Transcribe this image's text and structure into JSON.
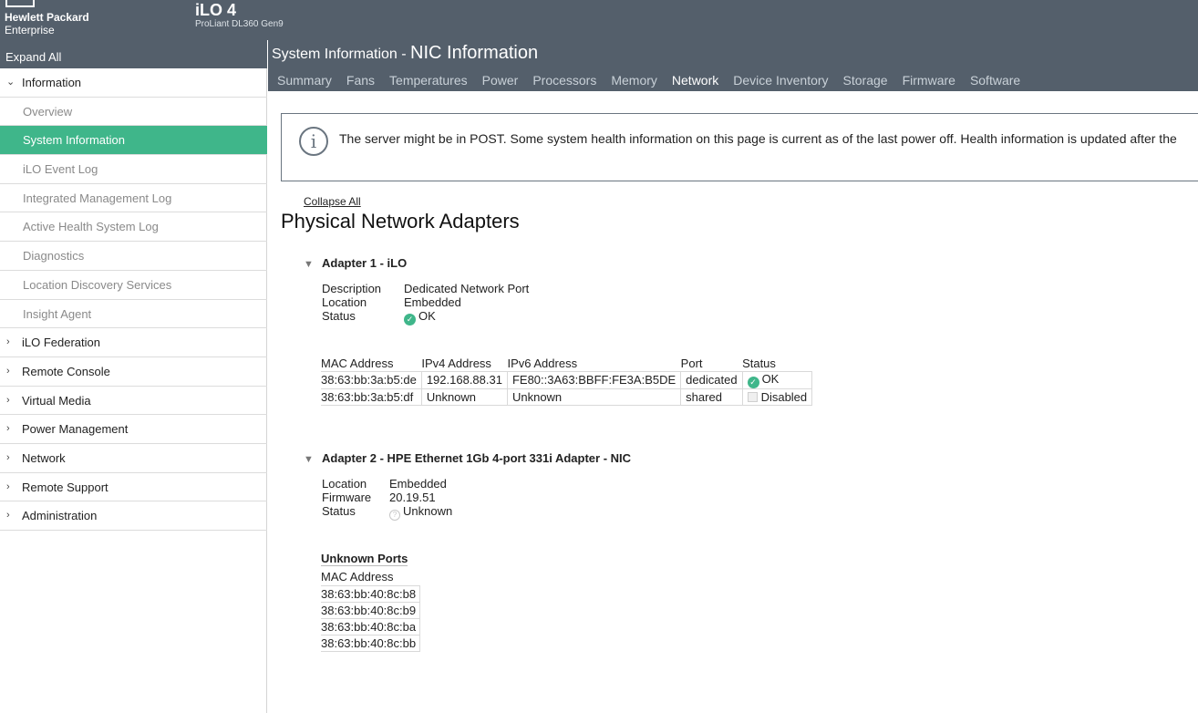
{
  "brand": {
    "line1": "Hewlett Packard",
    "line2": "Enterprise"
  },
  "product": {
    "name": "iLO 4",
    "model": "ProLiant DL360 Gen9"
  },
  "sidebar": {
    "expand_all": "Expand All",
    "items": [
      {
        "label": "Information",
        "type": "section",
        "expanded": true
      },
      {
        "label": "Overview",
        "type": "sub"
      },
      {
        "label": "System Information",
        "type": "sub",
        "active": true
      },
      {
        "label": "iLO Event Log",
        "type": "sub"
      },
      {
        "label": "Integrated Management Log",
        "type": "sub"
      },
      {
        "label": "Active Health System Log",
        "type": "sub"
      },
      {
        "label": "Diagnostics",
        "type": "sub"
      },
      {
        "label": "Location Discovery Services",
        "type": "sub"
      },
      {
        "label": "Insight Agent",
        "type": "sub"
      },
      {
        "label": "iLO Federation",
        "type": "section"
      },
      {
        "label": "Remote Console",
        "type": "section"
      },
      {
        "label": "Virtual Media",
        "type": "section"
      },
      {
        "label": "Power Management",
        "type": "section"
      },
      {
        "label": "Network",
        "type": "section"
      },
      {
        "label": "Remote Support",
        "type": "section"
      },
      {
        "label": "Administration",
        "type": "section"
      }
    ]
  },
  "header": {
    "title_prefix": "System Information - ",
    "title_main": "NIC Information"
  },
  "tabs": [
    {
      "label": "Summary"
    },
    {
      "label": "Fans"
    },
    {
      "label": "Temperatures"
    },
    {
      "label": "Power"
    },
    {
      "label": "Processors"
    },
    {
      "label": "Memory"
    },
    {
      "label": "Network",
      "active": true
    },
    {
      "label": "Device Inventory"
    },
    {
      "label": "Storage"
    },
    {
      "label": "Firmware"
    },
    {
      "label": "Software"
    }
  ],
  "alert": {
    "icon": "info-icon",
    "text": "The server might be in POST. Some system health information on this page is current as of the last power off. Health information is updated after the"
  },
  "content": {
    "collapse_all": "Collapse All",
    "heading": "Physical Network Adapters",
    "adapter1": {
      "title": "Adapter 1 - iLO",
      "details": [
        {
          "key": "Description",
          "value": "Dedicated Network Port"
        },
        {
          "key": "Location",
          "value": "Embedded"
        },
        {
          "key": "Status",
          "value": "OK"
        }
      ],
      "table": {
        "headers": [
          "MAC Address",
          "IPv4 Address",
          "IPv6 Address",
          "Port",
          "Status"
        ],
        "rows": [
          {
            "mac": "38:63:bb:3a:b5:de",
            "ipv4": "192.168.88.31",
            "ipv6": "FE80::3A63:BBFF:FE3A:B5DE",
            "port": "dedicated",
            "status": "OK"
          },
          {
            "mac": "38:63:bb:3a:b5:df",
            "ipv4": "Unknown",
            "ipv6": "Unknown",
            "port": "shared",
            "status": "Disabled"
          }
        ]
      }
    },
    "adapter2": {
      "title": "Adapter 2 - HPE Ethernet 1Gb 4-port 331i Adapter - NIC",
      "details": [
        {
          "key": "Location",
          "value": "Embedded"
        },
        {
          "key": "Firmware",
          "value": "20.19.51"
        },
        {
          "key": "Status",
          "value": "Unknown"
        }
      ],
      "ports_title": "Unknown Ports",
      "ports_header": "MAC Address",
      "ports": [
        "38:63:bb:40:8c:b8",
        "38:63:bb:40:8c:b9",
        "38:63:bb:40:8c:ba",
        "38:63:bb:40:8c:bb"
      ]
    }
  }
}
